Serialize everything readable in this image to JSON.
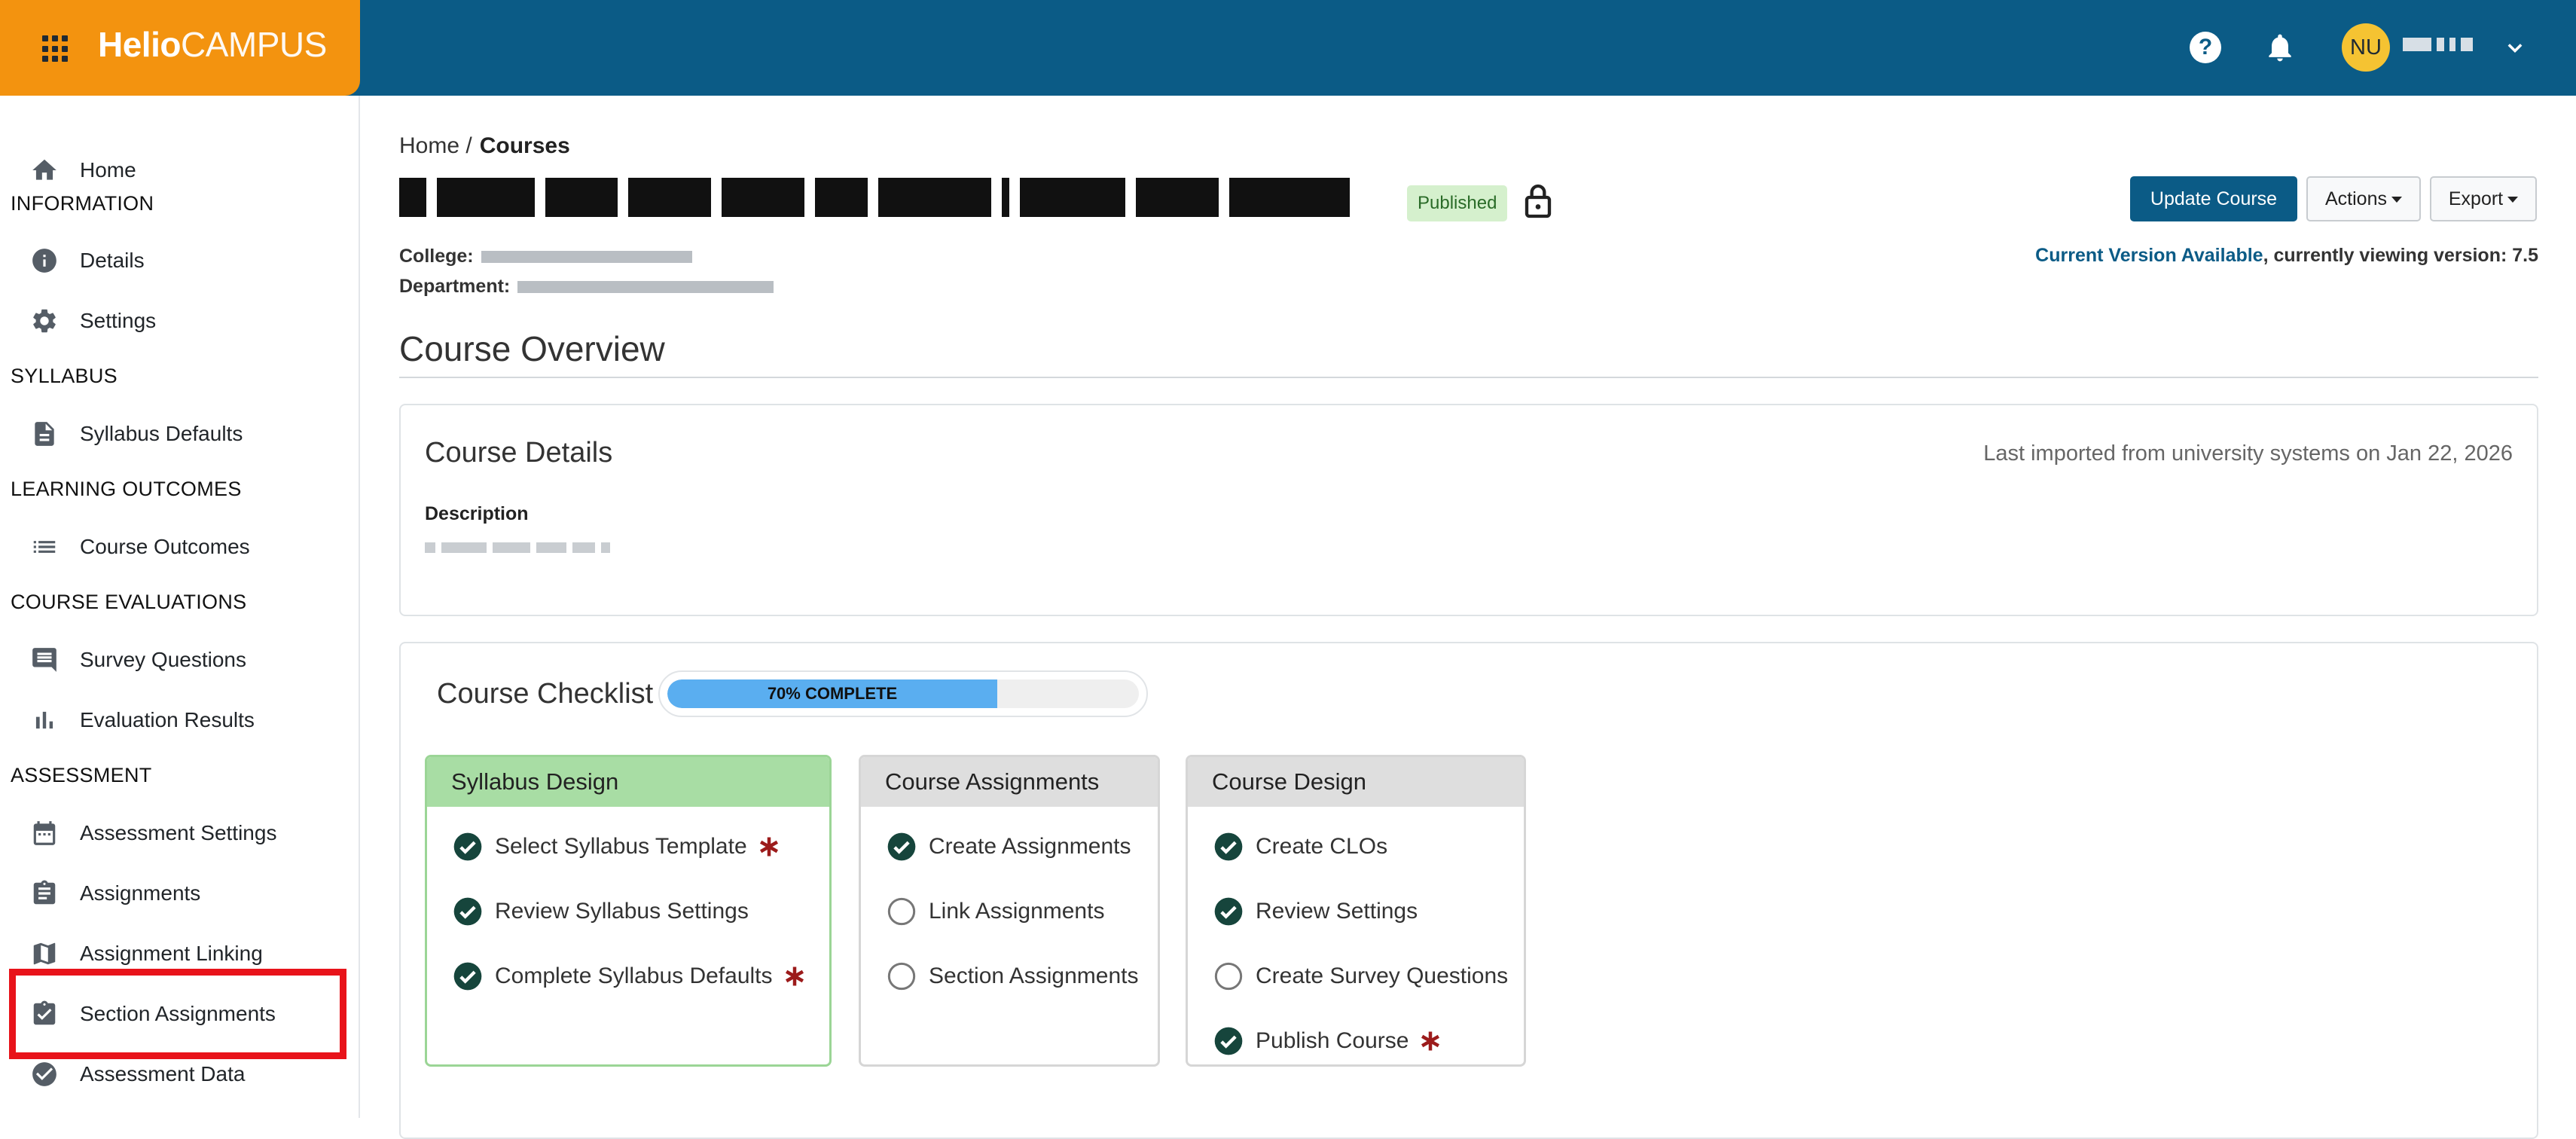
{
  "app": {
    "brand_bold": "Helio",
    "brand_light": "CAMPUS",
    "help_glyph": "?",
    "avatar_initials": "NU",
    "accent_color": "#0b5b86",
    "brand_color": "#f3930f"
  },
  "sidebar": {
    "home": "Home",
    "sections": [
      {
        "heading": "INFORMATION",
        "items": [
          {
            "label": "Details",
            "icon": "info-icon"
          },
          {
            "label": "Settings",
            "icon": "gear-icon"
          }
        ]
      },
      {
        "heading": "SYLLABUS",
        "items": [
          {
            "label": "Syllabus Defaults",
            "icon": "document-icon"
          }
        ]
      },
      {
        "heading": "LEARNING OUTCOMES",
        "items": [
          {
            "label": "Course Outcomes",
            "icon": "list-icon"
          }
        ]
      },
      {
        "heading": "COURSE EVALUATIONS",
        "items": [
          {
            "label": "Survey Questions",
            "icon": "comment-icon"
          },
          {
            "label": "Evaluation Results",
            "icon": "bar-chart-icon"
          }
        ]
      },
      {
        "heading": "ASSESSMENT",
        "items": [
          {
            "label": "Assessment Settings",
            "icon": "calendar-icon"
          },
          {
            "label": "Assignments",
            "icon": "clipboard-icon"
          },
          {
            "label": "Assignment Linking",
            "icon": "map-icon"
          },
          {
            "label": "Section Assignments",
            "icon": "clipboard-check-icon"
          },
          {
            "label": "Assessment Data",
            "icon": "check-circle-icon"
          }
        ]
      }
    ]
  },
  "breadcrumb": {
    "home": "Home /",
    "current": "Courses"
  },
  "course": {
    "status": "Published",
    "college_label": "College:",
    "department_label": "Department:"
  },
  "actions": {
    "update": "Update Course",
    "actions": "Actions",
    "export": "Export"
  },
  "version": {
    "link": "Current Version Available",
    "rest": ", currently viewing version: 7.5"
  },
  "overview": {
    "title": "Course Overview",
    "details_title": "Course Details",
    "imported": "Last imported from university systems on Jan 22, 2026",
    "description_label": "Description"
  },
  "checklist": {
    "title": "Course Checklist",
    "progress_label": "70% COMPLETE",
    "progress_fraction": 0.7,
    "groups": [
      {
        "title": "Syllabus Design",
        "complete": true,
        "items": [
          {
            "label": "Select Syllabus Template",
            "done": true,
            "required": true
          },
          {
            "label": "Review Syllabus Settings",
            "done": true,
            "required": false
          },
          {
            "label": "Complete Syllabus Defaults",
            "done": true,
            "required": true
          }
        ]
      },
      {
        "title": "Course Assignments",
        "complete": false,
        "items": [
          {
            "label": "Create Assignments",
            "done": true,
            "required": false
          },
          {
            "label": "Link Assignments",
            "done": false,
            "required": false
          },
          {
            "label": "Section Assignments",
            "done": false,
            "required": false
          }
        ]
      },
      {
        "title": "Course Design",
        "complete": false,
        "items": [
          {
            "label": "Create CLOs",
            "done": true,
            "required": false
          },
          {
            "label": "Review Settings",
            "done": true,
            "required": false
          },
          {
            "label": "Create Survey Questions",
            "done": false,
            "required": false
          },
          {
            "label": "Publish Course",
            "done": true,
            "required": true
          }
        ]
      }
    ]
  }
}
